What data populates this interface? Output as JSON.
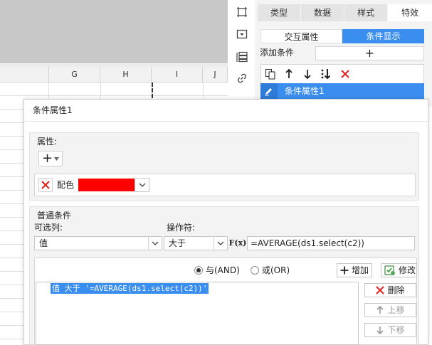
{
  "spreadsheet": {
    "columns": [
      "G",
      "H",
      "I",
      "J"
    ]
  },
  "right_toolbar": {
    "icons": [
      "cell-element-icon",
      "widget-icon",
      "stack-icon",
      "hyperlink-icon"
    ]
  },
  "panel": {
    "tabs": [
      "类型",
      "数据",
      "样式",
      "特效"
    ],
    "active_tab": "特效",
    "subtabs": [
      "交互属性",
      "条件显示"
    ],
    "active_subtab": "条件显示",
    "add_condition_label": "添加条件",
    "add_condition_button": "+",
    "toolbar_icons": [
      "copy-icon",
      "arrow-up-icon",
      "arrow-down-icon",
      "sort-icon",
      "delete-icon"
    ],
    "condition_item": "条件属性1"
  },
  "dialog": {
    "title": "条件属性1",
    "attributes_group": {
      "title": "属性:",
      "add_button": "+",
      "attribute_label": "配色",
      "attribute_color": "#ff0000"
    },
    "conditions_group": {
      "title": "普通条件",
      "column_label": "可选列:",
      "column_value": "值",
      "operator_label": "操作符:",
      "operator_value": "大于",
      "fx_label": "F(x)",
      "formula_value": "=AVERAGE(ds1.select(c2))",
      "and_label": "与(AND)",
      "or_label": "或(OR)",
      "and_checked": true,
      "add_button": "增加",
      "modify_button": "修改",
      "condition_list": [
        "值 大于 '=AVERAGE(ds1.select(c2))'"
      ],
      "delete_button": "删除",
      "move_up_button": "上移",
      "move_down_button": "下移"
    }
  },
  "colors": {
    "accent": "#3a8ef0",
    "delete_red": "#e02020",
    "swatch": "#ff0000"
  }
}
